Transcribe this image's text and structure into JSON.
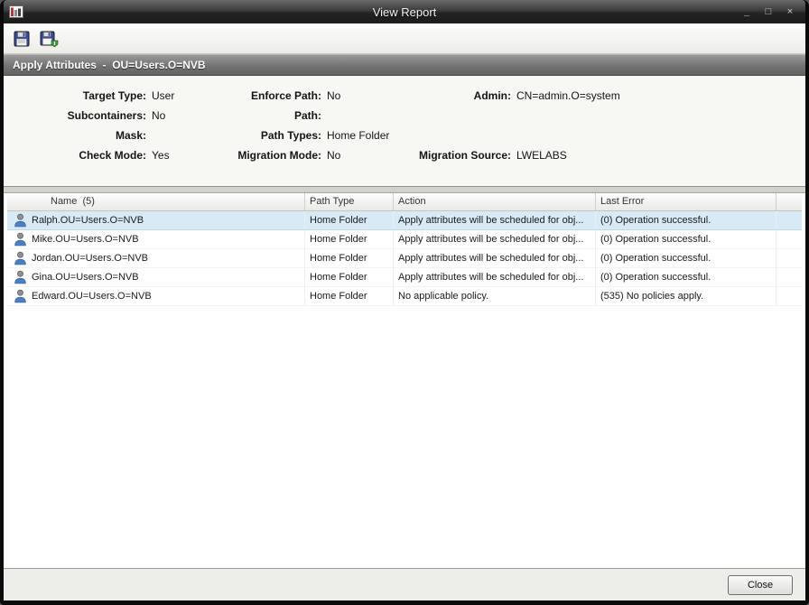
{
  "window": {
    "title": "View Report",
    "minimize": "_",
    "maximize": "□",
    "close": "×"
  },
  "toolbar": {
    "buttons": [
      {
        "icon": "save-icon"
      },
      {
        "icon": "save-as-icon"
      }
    ]
  },
  "report_header": {
    "title": "Apply Attributes  -  OU=Users.O=NVB"
  },
  "summary": {
    "rows": [
      {
        "l1": "Target Type:",
        "v1": "User",
        "l2": "Enforce Path:",
        "v2": "No",
        "l3": "Admin:",
        "v3": "CN=admin.O=system"
      },
      {
        "l1": "Subcontainers:",
        "v1": "No",
        "l2": "Path:",
        "v2": "",
        "l3": "",
        "v3": ""
      },
      {
        "l1": "Mask:",
        "v1": "",
        "l2": "Path Types:",
        "v2": "Home Folder",
        "l3": "",
        "v3": ""
      },
      {
        "l1": "Check Mode:",
        "v1": "Yes",
        "l2": "Migration Mode:",
        "v2": "No",
        "l3": "Migration Source:",
        "v3": "LWELABS"
      }
    ]
  },
  "table": {
    "columns": [
      "Name  (5)",
      "Path Type",
      "Action",
      "Last Error"
    ],
    "rows": [
      {
        "name": "Ralph.OU=Users.O=NVB",
        "path_type": "Home Folder",
        "action": "Apply attributes will be scheduled for obj...",
        "last_error": "(0) Operation successful."
      },
      {
        "name": "Mike.OU=Users.O=NVB",
        "path_type": "Home Folder",
        "action": "Apply attributes will be scheduled for obj...",
        "last_error": "(0) Operation successful."
      },
      {
        "name": "Jordan.OU=Users.O=NVB",
        "path_type": "Home Folder",
        "action": "Apply attributes will be scheduled for obj...",
        "last_error": "(0) Operation successful."
      },
      {
        "name": "Gina.OU=Users.O=NVB",
        "path_type": "Home Folder",
        "action": "Apply attributes will be scheduled for obj...",
        "last_error": "(0) Operation successful."
      },
      {
        "name": "Edward.OU=Users.O=NVB",
        "path_type": "Home Folder",
        "action": "No applicable policy.",
        "last_error": "(535) No policies apply."
      }
    ]
  },
  "footer": {
    "close_label": "Close"
  }
}
